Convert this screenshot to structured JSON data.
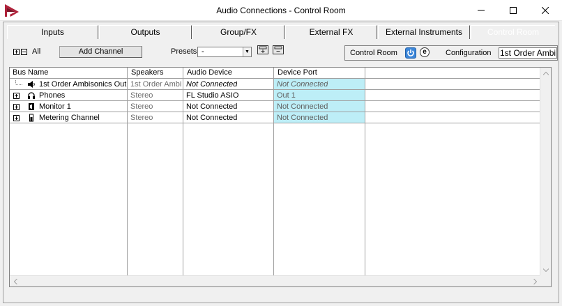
{
  "window": {
    "title": "Audio Connections - Control Room",
    "minimize_icon": "minimize-icon",
    "maximize_icon": "maximize-icon",
    "close_icon": "close-icon",
    "logo_icon": "app-logo-icon"
  },
  "tabs": [
    {
      "label": "Inputs"
    },
    {
      "label": "Outputs"
    },
    {
      "label": "Group/FX"
    },
    {
      "label": "External FX"
    },
    {
      "label": "External Instruments"
    },
    {
      "label": "Control Room"
    }
  ],
  "toolbar": {
    "all_label": "All",
    "add_channel_label": "Add Channel",
    "presets_label": "Presets",
    "presets_value": "-",
    "control_room_label": "Control Room",
    "power_icon": "power-icon",
    "e_label": "e",
    "configuration_label": "Configuration",
    "configuration_value": "1st Order Ambi"
  },
  "table": {
    "columns": [
      "Bus Name",
      "Speakers",
      "Audio Device",
      "Device Port"
    ],
    "rows": [
      {
        "name": "1st Order Ambisonics Out",
        "icon": "speaker-icon",
        "speakers": "1st Order Ambi",
        "device": "Not Connected",
        "port": "Not Connected",
        "italic": true
      },
      {
        "name": "Phones",
        "icon": "headphones-icon",
        "speakers": "Stereo",
        "device": "FL Studio ASIO",
        "port": "Out 1",
        "italic": false
      },
      {
        "name": "Monitor 1",
        "icon": "monitor-speaker-icon",
        "speakers": "Stereo",
        "device": "Not Connected",
        "port": "Not Connected",
        "italic": false
      },
      {
        "name": "Metering Channel",
        "icon": "meter-icon",
        "speakers": "Stereo",
        "device": "Not Connected",
        "port": "Not Connected",
        "italic": false
      }
    ]
  },
  "colors": {
    "port_highlight": "#bdeef7",
    "power_button": "#3c86d8"
  }
}
